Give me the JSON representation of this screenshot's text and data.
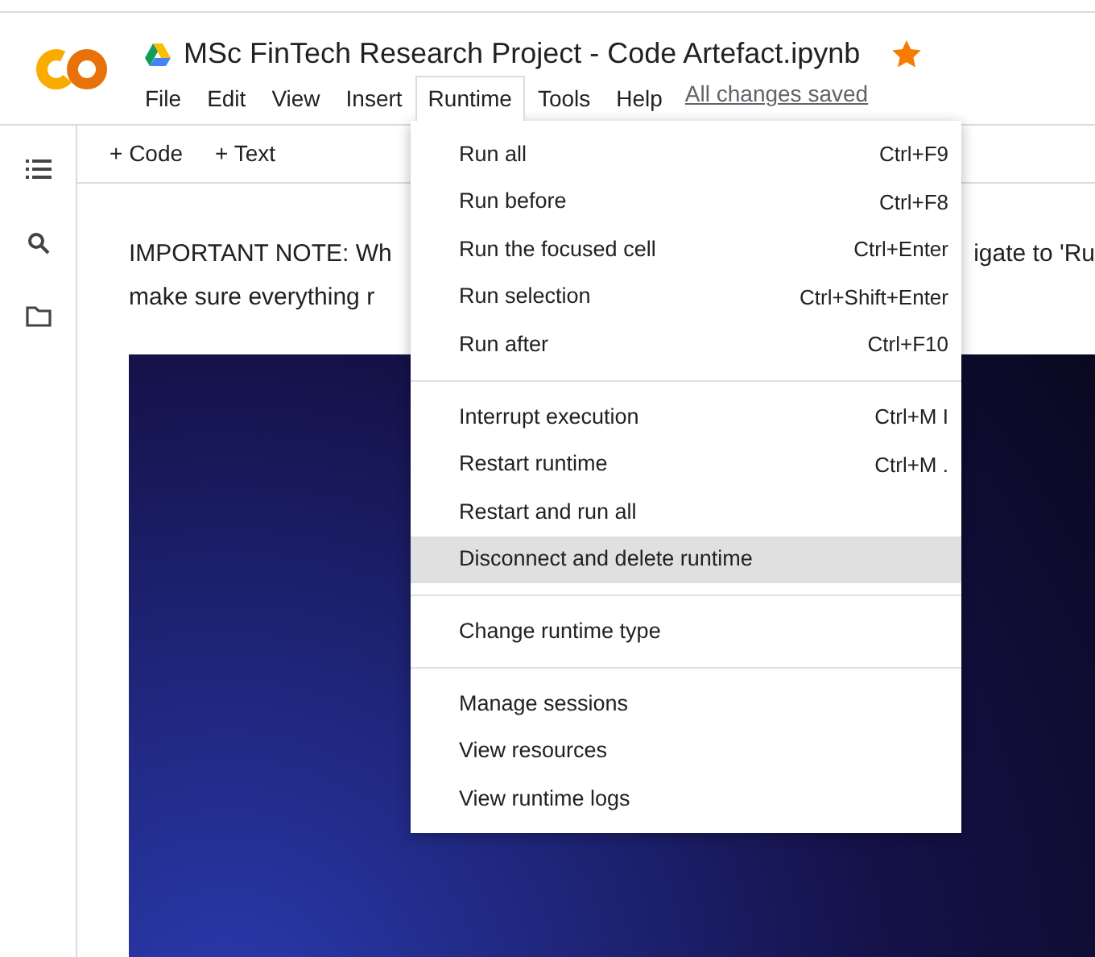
{
  "header": {
    "title": "MSc FinTech Research Project - Code Artefact.ipynb",
    "starred": true,
    "menus": [
      {
        "label": "File",
        "selected": false
      },
      {
        "label": "Edit",
        "selected": false
      },
      {
        "label": "View",
        "selected": false
      },
      {
        "label": "Insert",
        "selected": false
      },
      {
        "label": "Runtime",
        "selected": true
      },
      {
        "label": "Tools",
        "selected": false
      },
      {
        "label": "Help",
        "selected": false
      }
    ],
    "save_status": "All changes saved"
  },
  "toolbar": [
    {
      "label": "+ Code"
    },
    {
      "label": "+ Text"
    }
  ],
  "note": {
    "line_1_left": "IMPORTANT NOTE: Wh",
    "line_1_right": "igate to 'Ru",
    "line_2_left": "make sure everything r"
  },
  "runtime_menu": [
    [
      {
        "label": "Run all",
        "shortcut": "Ctrl+F9",
        "selected": false
      },
      {
        "label": "Run before",
        "shortcut": "Ctrl+F8",
        "selected": false
      },
      {
        "label": "Run the focused cell",
        "shortcut": "Ctrl+Enter",
        "selected": false
      },
      {
        "label": "Run selection",
        "shortcut": "Ctrl+Shift+Enter",
        "selected": false
      },
      {
        "label": "Run after",
        "shortcut": "Ctrl+F10",
        "selected": false
      }
    ],
    [
      {
        "label": "Interrupt execution",
        "shortcut": "Ctrl+M I",
        "selected": false
      },
      {
        "label": "Restart runtime",
        "shortcut": "Ctrl+M .",
        "selected": false
      },
      {
        "label": "Restart and run all",
        "selected": false
      },
      {
        "label": "Disconnect and delete runtime",
        "selected": true
      }
    ],
    [
      {
        "label": "Change runtime type",
        "selected": false
      }
    ],
    [
      {
        "label": "Manage sessions",
        "selected": false
      },
      {
        "label": "View resources",
        "selected": false
      },
      {
        "label": "View runtime logs",
        "selected": false
      }
    ]
  ]
}
